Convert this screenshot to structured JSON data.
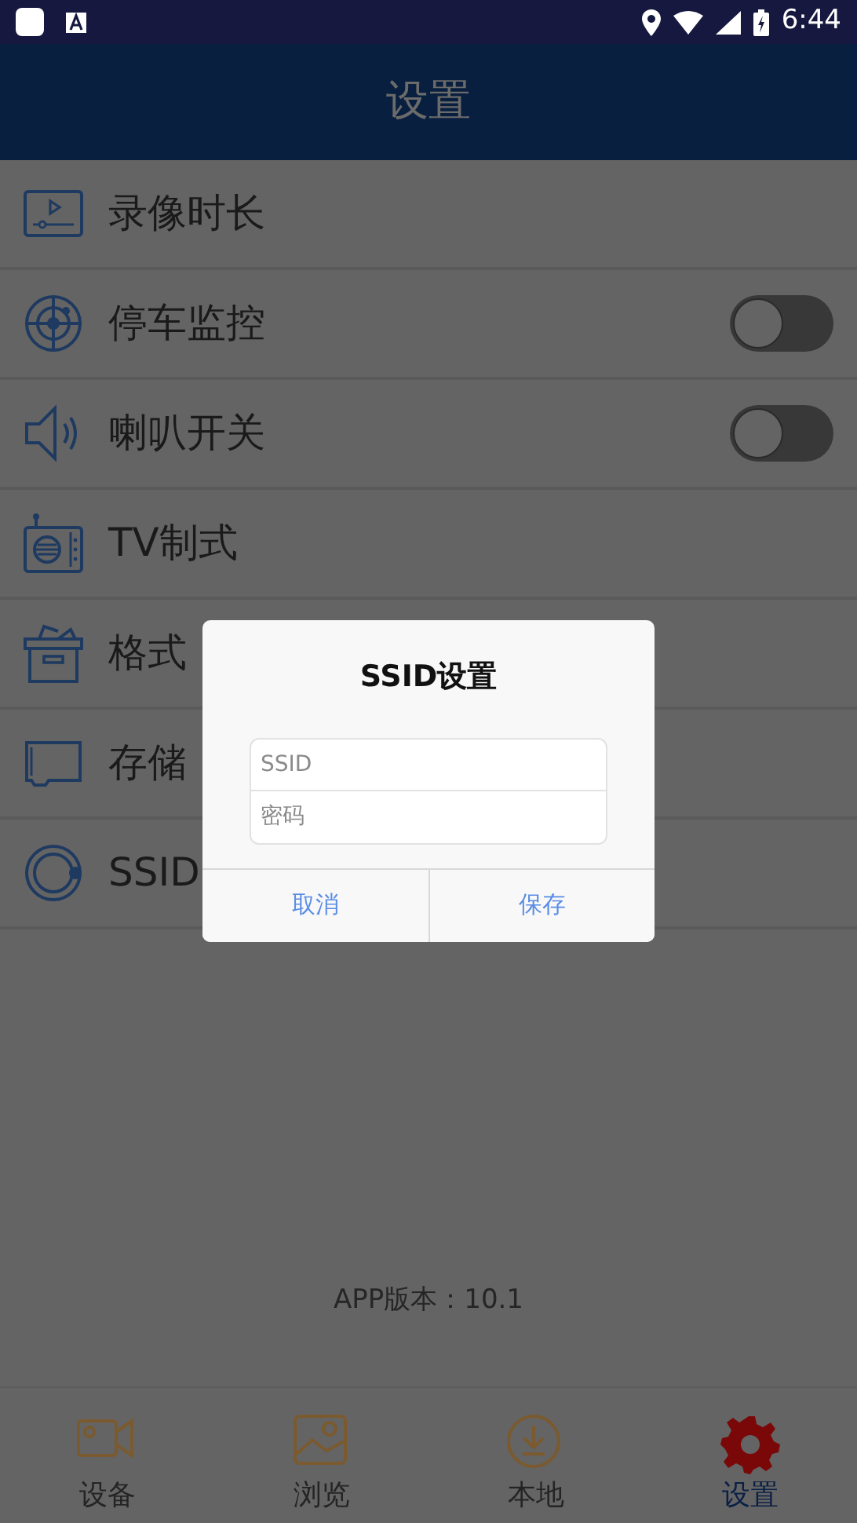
{
  "status_bar": {
    "time": "6:44"
  },
  "header": {
    "title": "设置"
  },
  "settings": [
    {
      "label": "录像时长",
      "kind": "plain"
    },
    {
      "label": "停车监控",
      "kind": "toggle",
      "on": false
    },
    {
      "label": "喇叭开关",
      "kind": "toggle",
      "on": false
    },
    {
      "label": "TV制式",
      "kind": "plain"
    },
    {
      "label": "格式",
      "kind": "plain"
    },
    {
      "label": "存储",
      "kind": "plain"
    },
    {
      "label": "SSID",
      "kind": "plain"
    }
  ],
  "version": "APP版本：10.1",
  "dialog": {
    "title": "SSID设置",
    "fields": [
      {
        "placeholder": "SSID"
      },
      {
        "placeholder": "密码"
      }
    ],
    "buttons": [
      "取消",
      "保存"
    ]
  },
  "tabs": [
    {
      "label": "设备",
      "selected": false
    },
    {
      "label": "浏览",
      "selected": false
    },
    {
      "label": "本地",
      "selected": false
    },
    {
      "label": "设置",
      "selected": true
    }
  ]
}
